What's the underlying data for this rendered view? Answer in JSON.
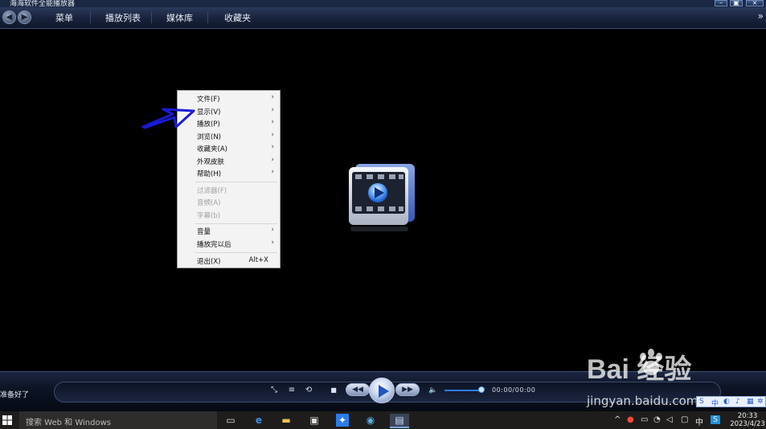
{
  "window": {
    "title": "海海软件全能播放器",
    "minimize_glyph": "–",
    "restore_glyph": "▣",
    "close_glyph": "×"
  },
  "nav": {
    "back_icon": "back-arrow-icon",
    "forward_icon": "forward-arrow-icon",
    "more_glyph": "»"
  },
  "menubar": {
    "items": [
      {
        "label": "菜单"
      },
      {
        "label": "播放列表"
      },
      {
        "label": "媒体库"
      },
      {
        "label": "收藏夹"
      }
    ]
  },
  "context_menu": {
    "items": [
      {
        "label": "文件(F)",
        "submenu": true,
        "enabled": true
      },
      {
        "label": "显示(V)",
        "submenu": true,
        "enabled": true
      },
      {
        "label": "播放(P)",
        "submenu": true,
        "enabled": true
      },
      {
        "label": "浏览(N)",
        "submenu": true,
        "enabled": true
      },
      {
        "label": "收藏夹(A)",
        "submenu": true,
        "enabled": true
      },
      {
        "label": "外观皮肤",
        "submenu": true,
        "enabled": true
      },
      {
        "label": "帮助(H)",
        "submenu": true,
        "enabled": true
      },
      {
        "label": "过滤器(F)",
        "submenu": false,
        "enabled": false
      },
      {
        "label": "音频(A)",
        "submenu": false,
        "enabled": false
      },
      {
        "label": "字幕(b)",
        "submenu": false,
        "enabled": false
      },
      {
        "label": "音量",
        "submenu": true,
        "enabled": true
      },
      {
        "label": "播放完以后",
        "submenu": true,
        "enabled": true
      },
      {
        "label": "退出(X)",
        "shortcut": "Alt+X",
        "submenu": false,
        "enabled": true
      }
    ],
    "arrow_glyph": "›"
  },
  "controls": {
    "status_text": "准备好了",
    "time_text": "00:00/00:00",
    "volume_level": 0.9,
    "glyphs": {
      "shrink": "⤡",
      "list": "≡",
      "loop": "⟲",
      "stop": "■",
      "rewind": "◀◀",
      "forward": "▶▶",
      "volume": "🔈"
    }
  },
  "watermark": {
    "brand": "Bai  经验",
    "url": "jingyan.baidu.com"
  },
  "taskbar": {
    "search_placeholder": "搜索 Web 和 Windows",
    "tray": {
      "caret": "^",
      "ime_label": "中",
      "clock_time": "20:33",
      "clock_date": "2023/4/23"
    }
  },
  "colors": {
    "menubar_bg": "#17223b",
    "annotation_arrow": "#1a1ad6",
    "play_button": "#1f55c4",
    "taskbar_bg": "#1f1d1c"
  }
}
